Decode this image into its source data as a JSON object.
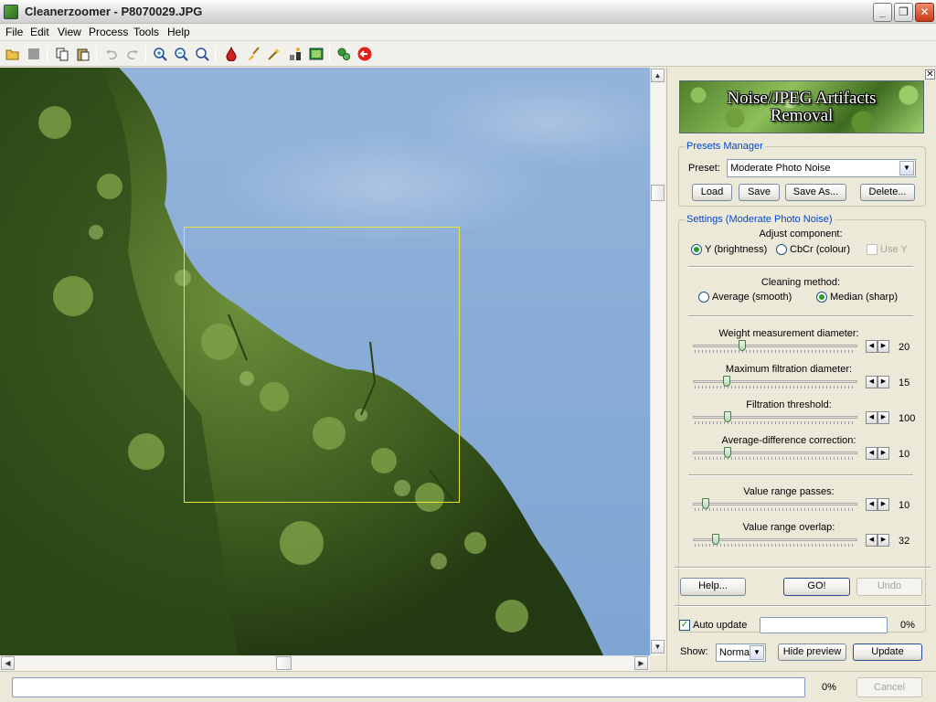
{
  "window": {
    "title": "Cleanerzoomer - P8070029.JPG"
  },
  "menu": [
    "File",
    "Edit",
    "View",
    "Process",
    "Tools",
    "Help"
  ],
  "panel": {
    "banner_line1": "Noise/JPEG Artifacts",
    "banner_line2": "Removal",
    "presets": {
      "group_label": "Presets Manager",
      "preset_label": "Preset:",
      "preset_value": "Moderate Photo Noise",
      "load": "Load",
      "save": "Save",
      "save_as": "Save As...",
      "delete": "Delete..."
    },
    "settings": {
      "group_label": "Settings (Moderate Photo Noise)",
      "adjust_label": "Adjust component:",
      "y_brightness": "Y (brightness)",
      "cbcr_colour": "CbCr (colour)",
      "use_y": "Use Y",
      "cleaning_label": "Cleaning method:",
      "average": "Average (smooth)",
      "median": "Median (sharp)",
      "sliders": [
        {
          "label": "Weight measurement diameter:",
          "value": "20"
        },
        {
          "label": "Maximum filtration diameter:",
          "value": "15"
        },
        {
          "label": "Filtration threshold:",
          "value": "100"
        },
        {
          "label": "Average-difference correction:",
          "value": "10"
        },
        {
          "label": "Value range passes:",
          "value": "10"
        },
        {
          "label": "Value range overlap:",
          "value": "32"
        }
      ]
    },
    "help": "Help...",
    "go": "GO!",
    "undo": "Undo",
    "auto_update": "Auto update",
    "auto_progress": "0%",
    "show_label": "Show:",
    "show_value": "Normal",
    "hide_preview": "Hide preview",
    "update": "Update"
  },
  "status": {
    "progress": "0%",
    "cancel": "Cancel"
  },
  "colors": {
    "accent_label": "#0046d5",
    "selection": "#e6e63a",
    "close_button": "#c8381b"
  }
}
